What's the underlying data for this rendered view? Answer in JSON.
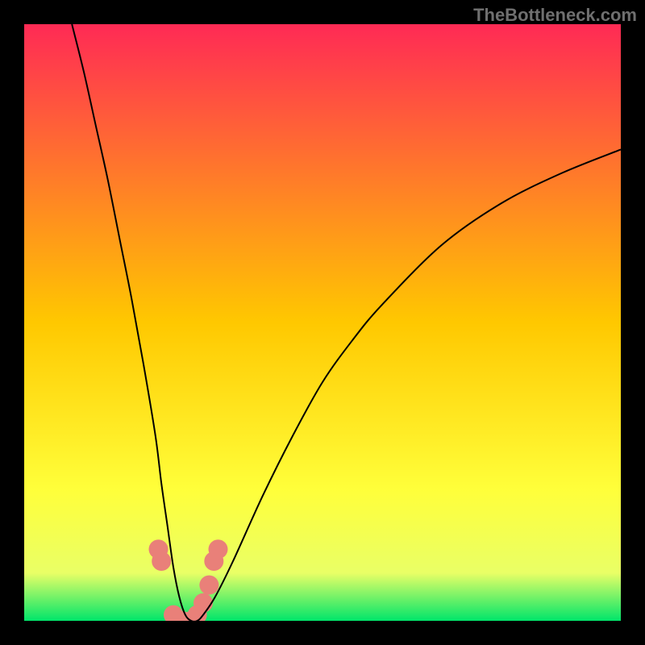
{
  "watermark": "TheBottleneck.com",
  "chart_data": {
    "type": "line",
    "title": "",
    "xlabel": "",
    "ylabel": "",
    "xlim": [
      0,
      100
    ],
    "ylim": [
      0,
      100
    ],
    "background_gradient": {
      "top_color": "#ff2a55",
      "mid_color": "#ffe600",
      "bottom_color": "#00e56a"
    },
    "curve": {
      "name": "bottleneck-curve",
      "color": "#000000",
      "stroke_width": 2,
      "x": [
        8,
        10,
        12,
        14,
        16,
        18,
        20,
        22,
        23,
        24,
        25,
        26,
        27,
        28,
        29,
        30,
        32,
        35,
        40,
        45,
        50,
        55,
        60,
        70,
        80,
        90,
        100
      ],
      "y": [
        100,
        92,
        83,
        74,
        64,
        54,
        43,
        31,
        23,
        16,
        9,
        4,
        1,
        0,
        0,
        1,
        4,
        10,
        21,
        31,
        40,
        47,
        53,
        63,
        70,
        75,
        79
      ]
    },
    "markers": {
      "name": "highlighted-points",
      "color": "#e98079",
      "radius": 12,
      "points": [
        {
          "x": 22.5,
          "y": 12
        },
        {
          "x": 23.0,
          "y": 10
        },
        {
          "x": 25.0,
          "y": 1
        },
        {
          "x": 26.5,
          "y": 0
        },
        {
          "x": 28.0,
          "y": 0
        },
        {
          "x": 29.0,
          "y": 1
        },
        {
          "x": 30.0,
          "y": 3
        },
        {
          "x": 31.0,
          "y": 6
        },
        {
          "x": 31.8,
          "y": 10
        },
        {
          "x": 32.5,
          "y": 12
        }
      ]
    }
  }
}
